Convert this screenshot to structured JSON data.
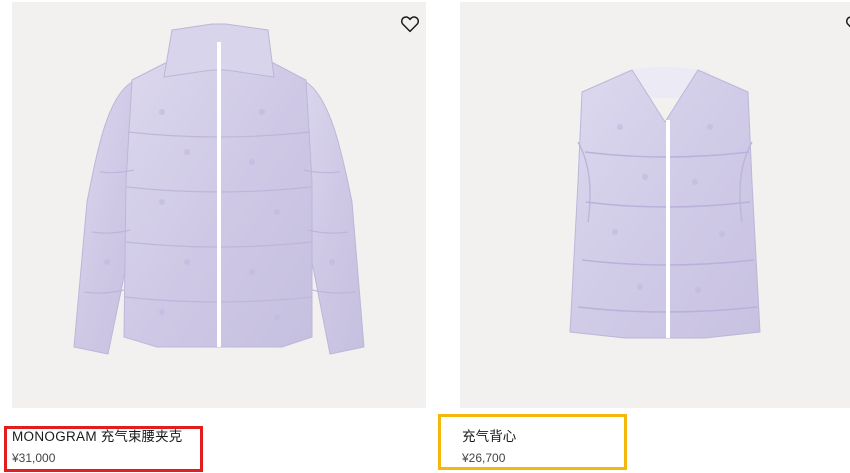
{
  "products": [
    {
      "name_brand": "MONOGRAM",
      "name_rest": " 充气束腰夹克",
      "price": "¥31,000",
      "image_icon": "puffer-jacket-image",
      "wishlist_icon": "heart-outline-icon"
    },
    {
      "name_brand": "",
      "name_rest": "充气背心",
      "price": "¥26,700",
      "image_icon": "puffer-vest-image",
      "wishlist_icon": "heart-outline-icon"
    }
  ],
  "colors": {
    "image_bg": "#f2f1f0",
    "garment": "#d7d3ea",
    "highlight_red": "#e01e1e",
    "highlight_yellow": "#f6b70c"
  }
}
